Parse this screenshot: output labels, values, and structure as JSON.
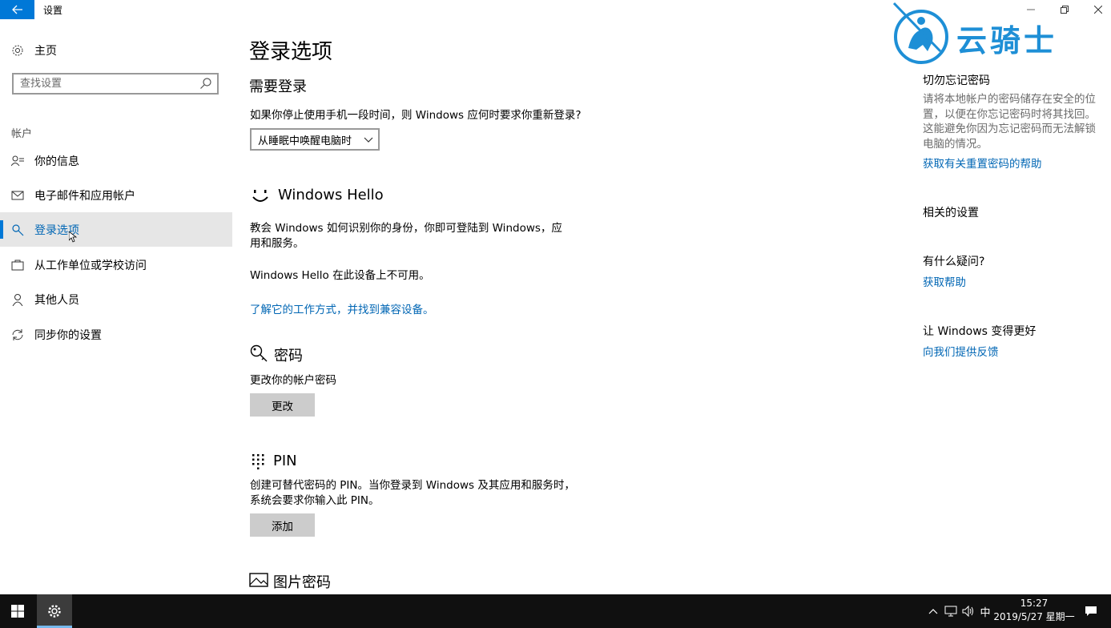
{
  "window": {
    "title": "设置",
    "back_icon": "arrow-left-icon",
    "controls": [
      "minimize-icon",
      "restore-icon",
      "close-icon"
    ]
  },
  "sidebar": {
    "home_label": "主页",
    "search_placeholder": "查找设置",
    "section_label": "帐户",
    "items": [
      {
        "label": "你的信息",
        "icon": "person-card-icon",
        "active": false
      },
      {
        "label": "电子邮件和应用帐户",
        "icon": "mail-icon",
        "active": false
      },
      {
        "label": "登录选项",
        "icon": "key-icon",
        "active": true
      },
      {
        "label": "从工作单位或学校访问",
        "icon": "briefcase-icon",
        "active": false
      },
      {
        "label": "其他人员",
        "icon": "person-icon",
        "active": false
      },
      {
        "label": "同步你的设置",
        "icon": "sync-icon",
        "active": false
      }
    ]
  },
  "main": {
    "page_title": "登录选项",
    "require_signin": {
      "heading": "需要登录",
      "question": "如果你停止使用手机一段时间，则 Windows 应何时要求你重新登录?",
      "dropdown_value": "从睡眠中唤醒电脑时"
    },
    "hello": {
      "heading": "Windows Hello",
      "desc": "教会 Windows 如何识别你的身份，你即可登陆到 Windows，应用和服务。",
      "unavailable": "Windows Hello 在此设备上不可用。",
      "link": "了解它的工作方式，并找到兼容设备。"
    },
    "password": {
      "heading": "密码",
      "desc": "更改你的帐户密码",
      "button": "更改"
    },
    "pin": {
      "heading": "PIN",
      "desc": "创建可替代密码的 PIN。当你登录到 Windows 及其应用和服务时，系统会要求你输入此 PIN。",
      "button": "添加"
    },
    "picture_password": {
      "heading": "图片密码"
    }
  },
  "right_panel": {
    "forgot_heading": "切勿忘记密码",
    "forgot_text": "请将本地帐户的密码储存在安全的位置，以便在你忘记密码时将其找回。这能避免你因为忘记密码而无法解锁电脑的情况。",
    "forgot_link": "获取有关重置密码的帮助",
    "related_heading": "相关的设置",
    "question_heading": "有什么疑问?",
    "help_link": "获取帮助",
    "improve_heading": "让 Windows 变得更好",
    "feedback_link": "向我们提供反馈"
  },
  "watermark": {
    "text": "云骑士"
  },
  "taskbar": {
    "tray_icons": [
      "chevron-up-icon",
      "network-icon",
      "volume-icon"
    ],
    "ime": "中",
    "time": "15:27",
    "date": "2019/5/27 星期一"
  },
  "colors": {
    "accent": "#0078d7",
    "link": "#0066b4",
    "taskbar": "#101010",
    "selected_nav": "#e6e6e6",
    "watermark": "#1e8fd6"
  }
}
